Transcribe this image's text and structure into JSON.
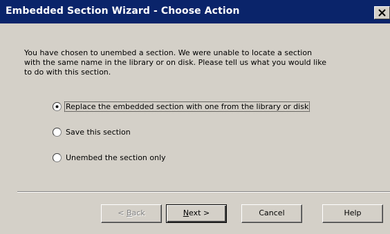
{
  "window": {
    "title": "Embedded Section Wizard - Choose Action",
    "close_glyph": "close-icon"
  },
  "message": {
    "line1": "You have chosen to unembed a section.  We were unable to locate a section",
    "line2": "with the same name in the library or on disk.  Please tell us what you would like",
    "line3": "to do with this section."
  },
  "options": [
    {
      "label": "Replace the embedded section with one from the library or disk",
      "selected": true
    },
    {
      "label": "Save this section",
      "selected": false
    },
    {
      "label": "Unembed the section only",
      "selected": false
    }
  ],
  "buttons": {
    "back_prefix": "< ",
    "back_mnemonic": "B",
    "back_rest": "ack",
    "next_mnemonic": "N",
    "next_rest": "ext >",
    "cancel": "Cancel",
    "help": "Help"
  },
  "colors": {
    "titlebar": "#0a246a",
    "face": "#d4d0c8"
  }
}
